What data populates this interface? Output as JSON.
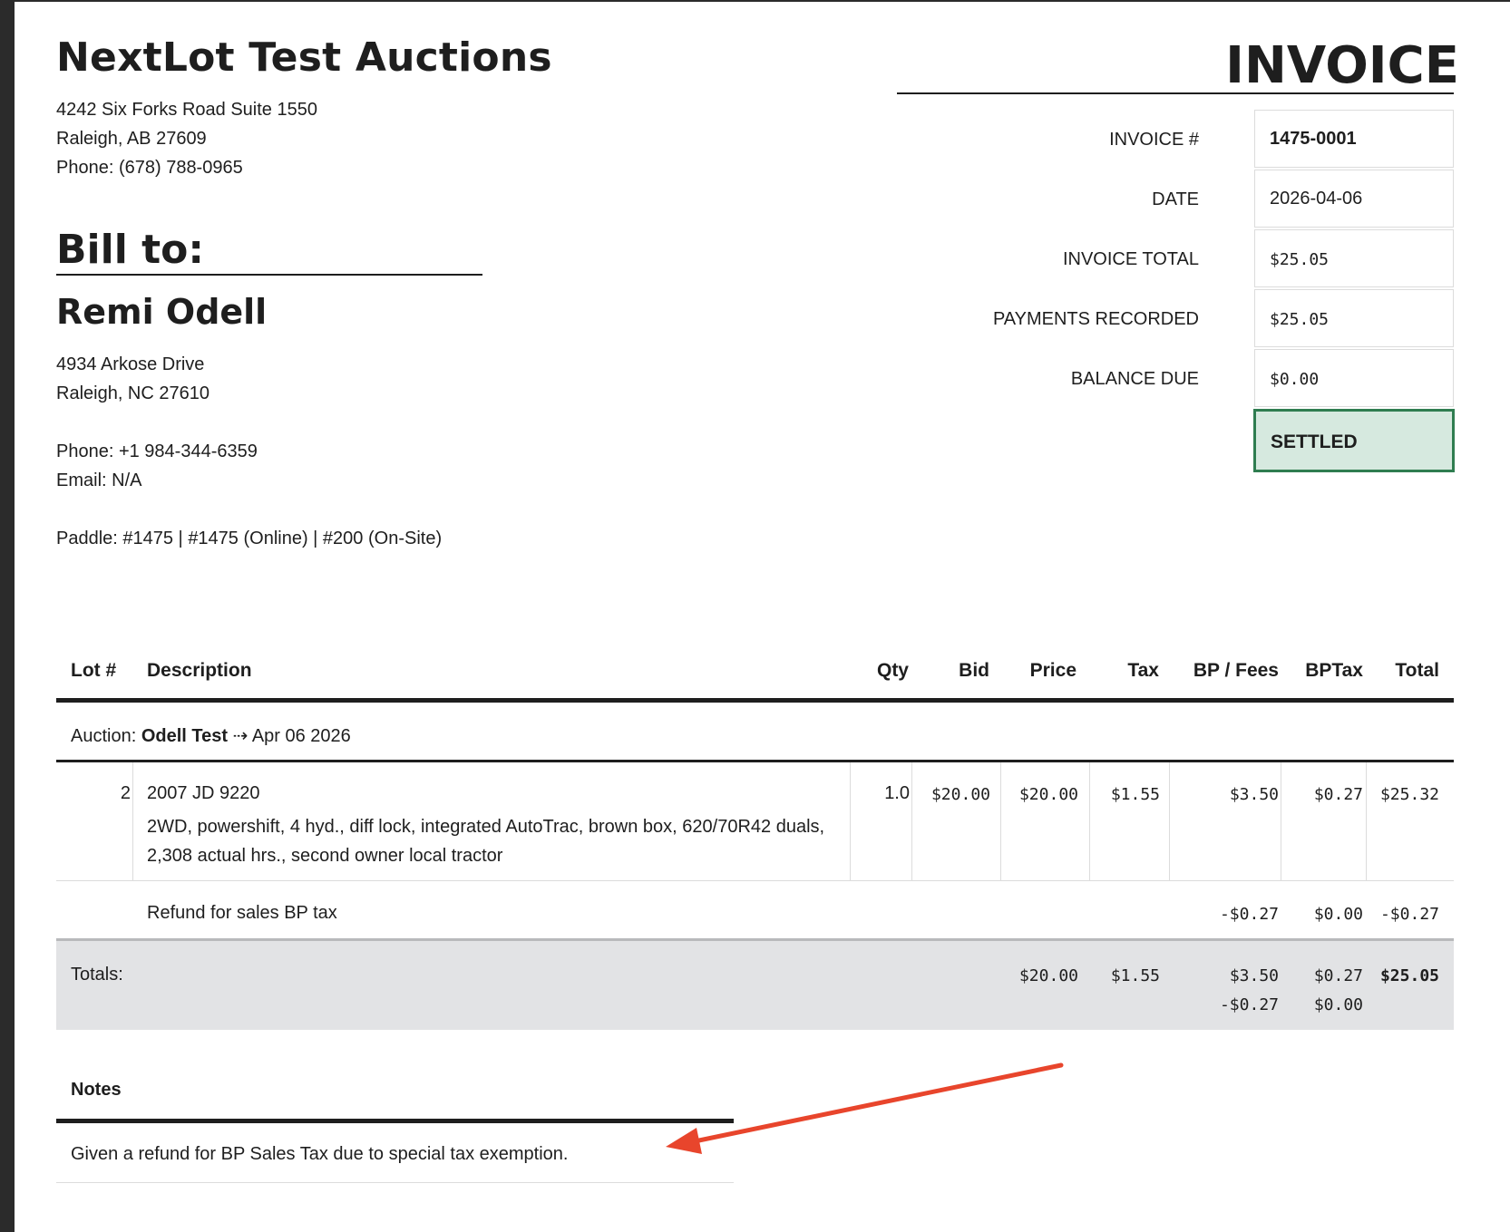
{
  "company": {
    "name": "NextLot Test Auctions",
    "address_line1": "4242 Six Forks Road Suite 1550",
    "address_line2": "Raleigh, AB 27609",
    "phone": "Phone: (678) 788-0965"
  },
  "invoice_title": "INVOICE",
  "bill_to": {
    "heading": "Bill to:",
    "name": "Remi Odell",
    "address_line1": "4934 Arkose Drive",
    "address_line2": "Raleigh, NC 27610",
    "phone": "Phone: +1 984-344-6359",
    "email": "Email: N/A",
    "paddle": "Paddle: #1475 | #1475 (Online) | #200 (On-Site)"
  },
  "info": {
    "invoice_no_label": "INVOICE #",
    "invoice_no": "1475-0001",
    "date_label": "DATE",
    "date": "2026-04-06",
    "total_label": "INVOICE TOTAL",
    "total": "$25.05",
    "payments_label": "PAYMENTS RECORDED",
    "payments": "$25.05",
    "balance_label": "BALANCE DUE",
    "balance": "$0.00",
    "status": "SETTLED",
    "status_color": "#2f7d50"
  },
  "table": {
    "headers": {
      "lot": "Lot #",
      "description": "Description",
      "qty": "Qty",
      "bid": "Bid",
      "price": "Price",
      "tax": "Tax",
      "bp_fees": "BP / Fees",
      "bptax": "BPTax",
      "total": "Total"
    },
    "auction_prefix": "Auction:",
    "auction_name": "Odell Test",
    "auction_date": "⇢ Apr 06 2026",
    "item": {
      "lot": "2",
      "title": "2007 JD 9220",
      "description": "2WD, powershift, 4 hyd., diff lock, integrated AutoTrac, brown box, 620/70R42 duals, 2,308 actual hrs., second owner local tractor",
      "qty": "1.0",
      "bid": "$20.00",
      "price": "$20.00",
      "tax": "$1.55",
      "bp_fees": "$3.50",
      "bptax": "$0.27",
      "total": "$25.32"
    },
    "refund": {
      "description": "Refund for sales BP tax",
      "bp_fees": "-$0.27",
      "bptax": "$0.00",
      "total": "-$0.27"
    },
    "totals": {
      "label": "Totals:",
      "price": "$20.00",
      "tax": "$1.55",
      "bp_fees_1": "$3.50",
      "bp_fees_2": "-$0.27",
      "bptax_1": "$0.27",
      "bptax_2": "$0.00",
      "total": "$25.05"
    }
  },
  "notes": {
    "heading": "Notes",
    "text": "Given a refund for BP Sales Tax due to special tax exemption."
  },
  "annotation_color": "#e8452c"
}
